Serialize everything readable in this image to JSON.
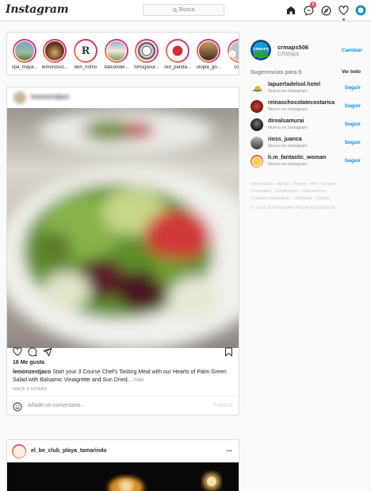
{
  "app": {
    "logo": "Instagram"
  },
  "search": {
    "placeholder": "Busca"
  },
  "nav": {
    "messages_badge": "5"
  },
  "stories": [
    {
      "label": "spa_maya..."
    },
    {
      "label": "lemonzest..."
    },
    {
      "label": "don_rufino"
    },
    {
      "label": "balcondel..."
    },
    {
      "label": "tortugasur..."
    },
    {
      "label": "red_panda..."
    },
    {
      "label": "utopia_go..."
    },
    {
      "label": "corre"
    }
  ],
  "post": {
    "header_user": "lemonzestjaco",
    "likes": "16 Me gusta",
    "caption_user": "lemonzestjaco",
    "caption_text": "Start your 3 Course Chef's Tasting Meal with our Hearts of Palm Green Salad with Balsamic Vinaigrette and Sun Dried...",
    "more": "más",
    "time": "HACE 8 HORAS",
    "comment_placeholder": "Añade un comentario...",
    "publish": "Publicar"
  },
  "post2": {
    "user": "el_be_club_playa_tamarindo",
    "more": "..."
  },
  "profile": {
    "username": "crmaps506",
    "name": "CRMaps",
    "switch": "Cambiar",
    "avatar_text": "CRMAPS"
  },
  "suggestions": {
    "title": "Sugerencias para ti",
    "see_all": "Ver todo",
    "items": [
      {
        "name": "lapuertadelsol.hotel",
        "sub": "Nuevo en Instagram",
        "action": "Seguir"
      },
      {
        "name": "reinaschocolatecostarica",
        "sub": "Nuevo en Instagram",
        "action": "Seguir"
      },
      {
        "name": "direalsamurai",
        "sub": "Nuevo en Instagram",
        "action": "Seguir"
      },
      {
        "name": "rioss_juanca",
        "sub": "Nuevo en Instagram",
        "action": "Seguir"
      },
      {
        "name": "h.m_fantastic_woman",
        "sub": "Nuevo en Instagram",
        "action": "Seguir"
      }
    ]
  },
  "footer": {
    "links_line1": "Información · Ayuda · Prensa · API · Empleo ·",
    "links_line2": "Privacidad · Condiciones · Ubicaciones ·",
    "links_line3": "Cuentas destacadas · Hashtags · Idioma",
    "copyright": "© 2021 INSTAGRAM FROM FACEBOOK"
  },
  "colors": {
    "accent": "#0095f6",
    "badge": "#ed4956",
    "border": "#dbdbdb"
  }
}
